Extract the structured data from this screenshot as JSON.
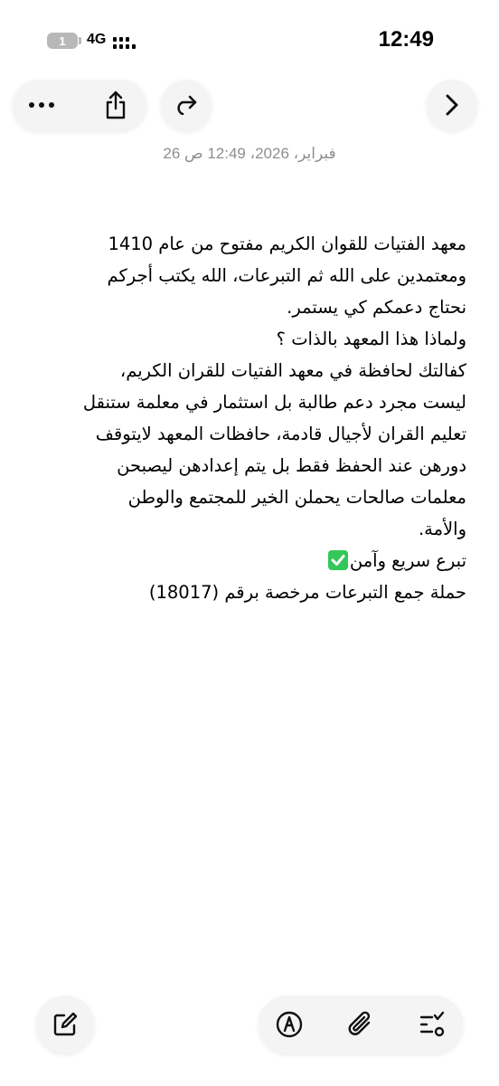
{
  "status_bar": {
    "time": "12:49",
    "network": "4G",
    "battery_level": "1",
    "icons": [
      "battery-icon",
      "signal-icon"
    ]
  },
  "toolbar": {
    "icons": [
      "more-icon",
      "share-icon",
      "redo-icon",
      "forward-chevron-icon"
    ]
  },
  "note": {
    "timestamp": "26 فبراير، 2026، 12:49 ص",
    "lines": [
      "معهد الفتيات للقوان الكريم مفتوح من عام 1410",
      "ومعتمدين على الله ثم التبرعات، الله يكتب أجركم",
      "نحتاج دعمكم كي يستمر.",
      "ولماذا هذا المعهد بالذات ؟",
      "كفالتك لحافظة في معهد الفتيات للقران الكريم،",
      "ليست مجرد دعم طالبة بل استثمار في معلمة ستنقل",
      "تعليم القران لأجيال قادمة، حافظات المعهد لايتوقف",
      "دورهن عند الحفظ فقط بل يتم إعدادهن ليصبحن",
      "معلمات صالحات يحملن الخير للمجتمع والوطن",
      "والأمة.",
      "تبرع سريع وآمن",
      "حملة جمع التبرعات مرخصة برقم (18017)"
    ],
    "check_icon": "check-mark-icon",
    "accent_green": "#34c759"
  },
  "bottom_toolbar": {
    "icons": [
      "compose-icon",
      "markup-pen-icon",
      "attachment-icon",
      "checklist-icon"
    ]
  }
}
